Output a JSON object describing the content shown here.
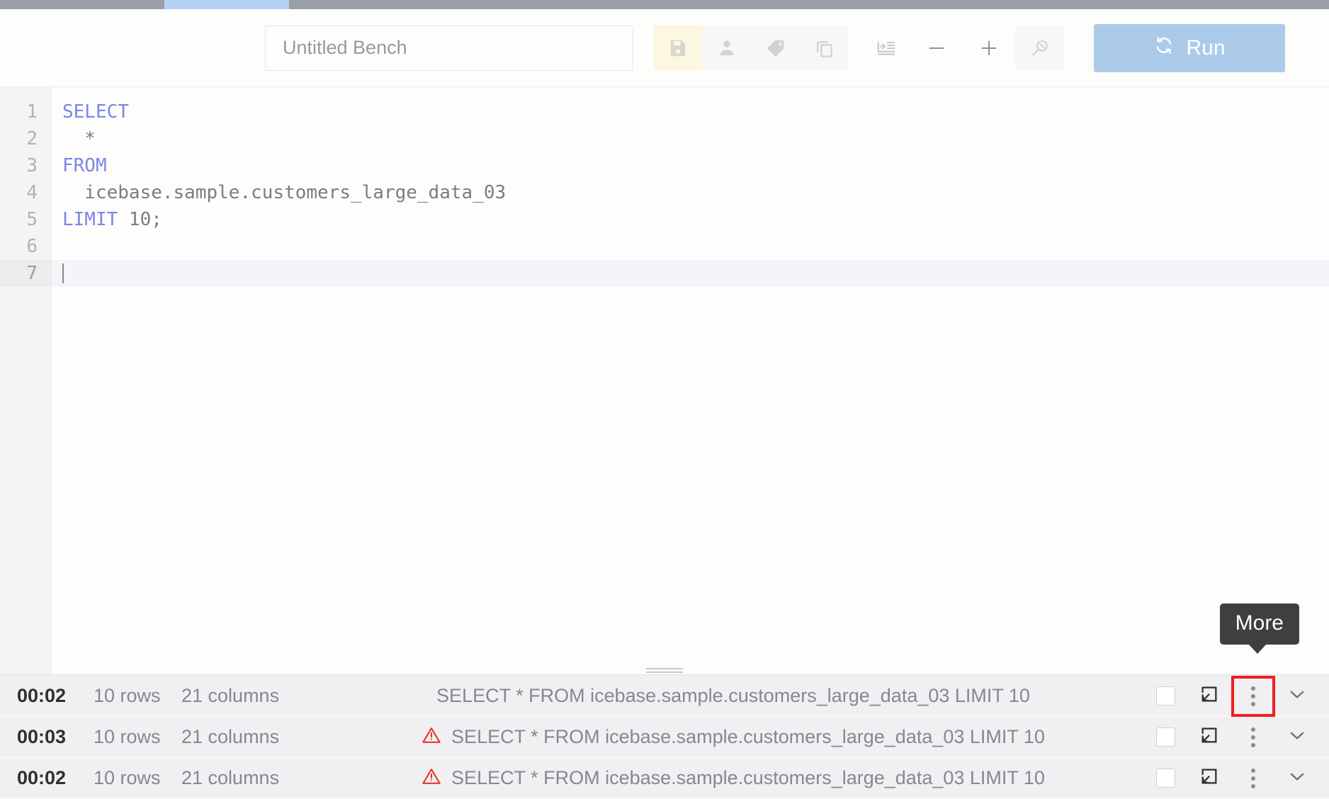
{
  "window": {
    "tabstrip": {
      "active_tab_label": ""
    }
  },
  "toolbar": {
    "bench_title_value": "",
    "bench_title_placeholder": "Untitled Bench",
    "buttons": [
      {
        "name": "save-icon",
        "label": "Save",
        "state": "highlighted"
      },
      {
        "name": "user-icon",
        "label": "Account",
        "state": "normal"
      },
      {
        "name": "tag-icon",
        "label": "Tags",
        "state": "normal"
      },
      {
        "name": "copy-icon",
        "label": "Duplicate",
        "state": "normal"
      },
      {
        "name": "format-icon",
        "label": "Format SQL",
        "state": "plain"
      },
      {
        "name": "minus-icon",
        "label": "Zoom out",
        "state": "plain"
      },
      {
        "name": "plus-icon",
        "label": "Zoom in",
        "state": "plain"
      },
      {
        "name": "query-search-icon",
        "label": "Find",
        "state": "normal"
      }
    ],
    "run_label": "Run",
    "run_icon": "refresh-icon",
    "run_color": "#accbeb"
  },
  "editor": {
    "line_numbers": [
      "1",
      "2",
      "3",
      "4",
      "5",
      "6",
      "7"
    ],
    "active_line": 7,
    "lines": [
      {
        "keyword": "SELECT",
        "rest": ""
      },
      {
        "keyword": "",
        "rest": "  *"
      },
      {
        "keyword": "FROM",
        "rest": ""
      },
      {
        "keyword": "",
        "rest": "  icebase.sample.customers_large_data_03"
      },
      {
        "keyword": "LIMIT",
        "rest": " 10;"
      },
      {
        "keyword": "",
        "rest": ""
      },
      {
        "keyword": "",
        "rest": ""
      }
    ],
    "keyword_color": "#7b86e8",
    "text_color": "#7d7d7d"
  },
  "tooltip": {
    "label": "More",
    "background": "#3f3f3f"
  },
  "results": {
    "highlight_color": "#f01e1e",
    "column_order": [
      "duration",
      "rows",
      "columns",
      "query"
    ],
    "rows": [
      {
        "duration": "00:02",
        "rows": "10 rows",
        "columns": "21 columns",
        "query": "SELECT * FROM icebase.sample.customers_large_data_03 LIMIT 10",
        "warning": false,
        "more_highlighted": true
      },
      {
        "duration": "00:03",
        "rows": "10 rows",
        "columns": "21 columns",
        "query": "SELECT * FROM icebase.sample.customers_large_data_03 LIMIT 10",
        "warning": true,
        "more_highlighted": false
      },
      {
        "duration": "00:02",
        "rows": "10 rows",
        "columns": "21 columns",
        "query": "SELECT * FROM icebase.sample.customers_large_data_03 LIMIT 10",
        "warning": true,
        "more_highlighted": false
      }
    ],
    "row_icons": {
      "checkbox": "checkbox-icon",
      "expand": "open-in-panel-icon",
      "more": "more-vertical-icon",
      "collapse": "chevron-down-icon",
      "warning": "warning-triangle-icon"
    }
  }
}
